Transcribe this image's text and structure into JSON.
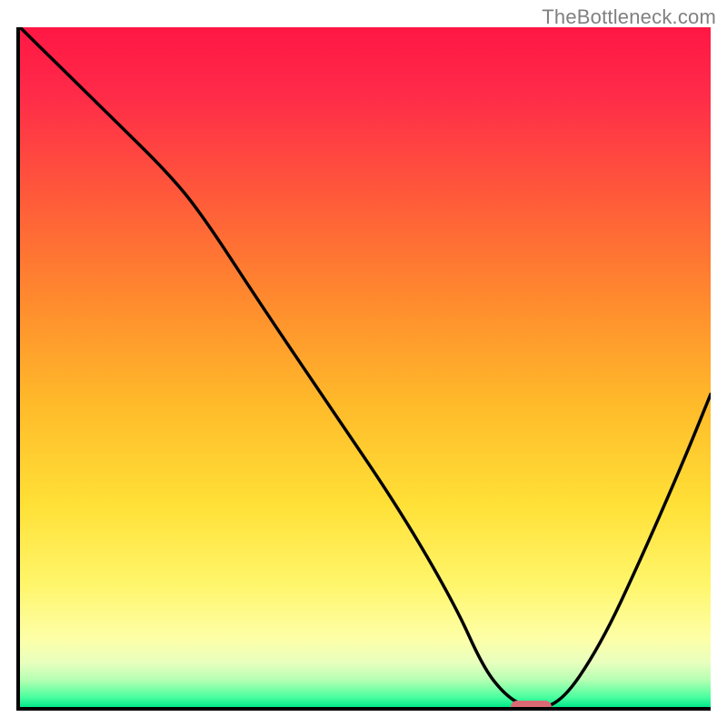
{
  "attribution": "TheBottleneck.com",
  "colors": {
    "axis": "#000000",
    "curve": "#000000",
    "marker_fill": "#d96a74",
    "gradient_stops": [
      {
        "offset": 0.0,
        "color": "#ff1744"
      },
      {
        "offset": 0.1,
        "color": "#ff2b49"
      },
      {
        "offset": 0.25,
        "color": "#ff5a3a"
      },
      {
        "offset": 0.4,
        "color": "#ff8a2e"
      },
      {
        "offset": 0.55,
        "color": "#ffb92a"
      },
      {
        "offset": 0.7,
        "color": "#ffe036"
      },
      {
        "offset": 0.82,
        "color": "#fff66b"
      },
      {
        "offset": 0.9,
        "color": "#fdffa8"
      },
      {
        "offset": 0.935,
        "color": "#e8ffbe"
      },
      {
        "offset": 0.96,
        "color": "#b6ffb3"
      },
      {
        "offset": 0.985,
        "color": "#4dffa0"
      },
      {
        "offset": 1.0,
        "color": "#00e98a"
      }
    ]
  },
  "chart_data": {
    "type": "line",
    "title": "",
    "xlabel": "",
    "ylabel": "",
    "xlim": [
      0,
      100
    ],
    "ylim": [
      0,
      100
    ],
    "x": [
      0,
      7,
      14,
      21,
      26,
      35,
      45,
      55,
      63,
      67,
      70,
      73,
      78,
      84,
      90,
      96,
      100
    ],
    "values": [
      100,
      93,
      86,
      79,
      73,
      59,
      44,
      29,
      15,
      6,
      2,
      0,
      0,
      9,
      22,
      36,
      46
    ],
    "marker": {
      "x_start": 71,
      "x_end": 77,
      "y": 0
    }
  }
}
